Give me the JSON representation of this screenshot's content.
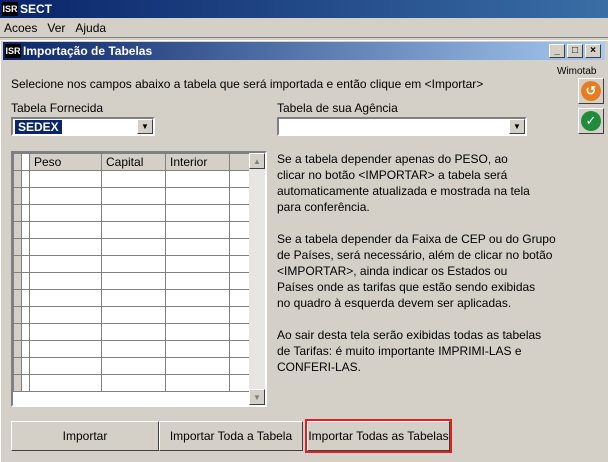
{
  "app": {
    "title": "SECT",
    "icon_text": "ISR"
  },
  "menu": [
    "Acoes",
    "Ver",
    "Ajuda"
  ],
  "window": {
    "title": "Importação de Tabelas",
    "controls": {
      "minimize": "_",
      "maximize": "□",
      "close": "×"
    }
  },
  "brand": "Wimotab",
  "instruction": "Selecione nos campos abaixo a tabela que será importada e então clique em <Importar>",
  "fields": {
    "supplied_label": "Tabela Fornecida",
    "supplied_value": "SEDEX",
    "agency_label": "Tabela de sua Agência",
    "agency_value": ""
  },
  "grid": {
    "columns": [
      "Peso",
      "Capital",
      "Interior"
    ],
    "rows": 13
  },
  "info": [
    "Se a tabela depender apenas do PESO, ao",
    "clicar no botão <IMPORTAR> a tabela será",
    "automaticamente atualizada e mostrada na tela",
    "para conferência.",
    "",
    "Se a tabela depender da Faixa de CEP ou do Grupo",
    "de Países, será necessário, além de clicar no botão",
    "<IMPORTAR>, ainda  indicar os Estados ou",
    "Países onde as tarifas que estão sendo exibidas",
    "no quadro à esquerda devem ser aplicadas.",
    "",
    "Ao sair desta tela serão exibidas todas as tabelas",
    "de Tarifas: é muito importante IMPRIMI-LAS e",
    "CONFERI-LAS."
  ],
  "buttons": {
    "import": "Importar",
    "import_all_table": "Importar Toda a Tabela",
    "import_all_tables": "Importar Todas as Tabelas"
  },
  "colors": {
    "highlight": "#e02020",
    "titlebar": "#0a246a",
    "undo_icon": "#e87d1e",
    "confirm_icon": "#1e8c3a"
  }
}
